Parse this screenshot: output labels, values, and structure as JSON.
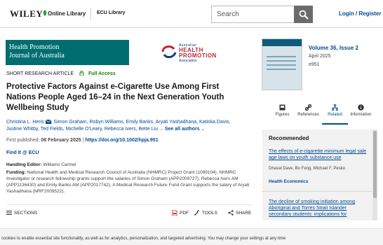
{
  "header": {
    "publisher": "WILEY",
    "online_library": "Online Library",
    "institution": "ECU Library",
    "search_placeholder": "Search",
    "login": "Login / Register"
  },
  "journal": {
    "name_line1": "Health Promotion",
    "name_line2": "Journal of Australia",
    "association_small": "Australian",
    "association_line1": "HEALTH",
    "association_line2": "PROMOTION",
    "association_bottom": "Association"
  },
  "article": {
    "type": "SHORT RESEARCH ARTICLE",
    "access": "Full Access",
    "title": "Protective Factors Against e-Cigarette Use Among First Nations People Aged 16–24 in the Next Generation Youth Wellbeing Study",
    "authors_line1": "Christina L. Heris",
    "authors_line1b": ", Simon Graham, Robyn Williams, Emily Banks, Aryati Yashadhana, Katiska Davis,",
    "authors_line2": "Justine Whitby, Ted Fields, Michelle O'Leary, Rebecca Ivers, Bette Liu ...",
    "see_all": "See all authors",
    "first_published_label": "First published: ",
    "first_published_date": "06 February 2025",
    "doi": "https://doi.org/10.1002/hpja.951",
    "find_it": "Find It @ ECU",
    "editor_label": "Handling Editor:",
    "editor_name": " Williams Carmel",
    "funding_label": "Funding:",
    "funding_text": " National Health and Medical Research Council of Australia (NHMRC) Project Grant (1089104). NHMRC Investigator or research fellowship grants support the salaries of Simon Graham (APP2009727), Rebecca Ivers AM (APP1136430) and Emily Banks AM (APP2017742). A Medical Research Future Fund Grant supports the salary of Aryati Yashadhana (MRF2009522)."
  },
  "toolbar": {
    "sections": "SECTIONS",
    "pdf": "PDF",
    "tools": "TOOLS",
    "share": "SHARE"
  },
  "issue": {
    "volume": "Volume 36, Issue 2",
    "date": "April 2025",
    "enumber": "e951"
  },
  "tabs": [
    {
      "label": "Figures",
      "icon": "image-icon"
    },
    {
      "label": "References",
      "icon": "link-icon"
    },
    {
      "label": "Related",
      "icon": "network-icon"
    },
    {
      "label": "Information",
      "icon": "info-icon"
    }
  ],
  "recommended": {
    "heading": "Recommended",
    "item1_title": "The effects of e-cigarette minimum legal sale age laws on youth substance use",
    "item1_authors": "Dhaval Dave, Bo Feng, Michael F. Pesko",
    "item1_journal": "Health Economics",
    "item2_title": "The decline of smoking initiation among Aboriginal and Torres Strait Islander secondary students: implications for"
  },
  "cookie": {
    "text": "cookies to enable essential site functionality, as well as for analytics, personalization, and targeted advertising. You may change your settings at any time"
  },
  "colors": {
    "link": "#004b93",
    "banner": "#006e71",
    "access": "#148200"
  }
}
